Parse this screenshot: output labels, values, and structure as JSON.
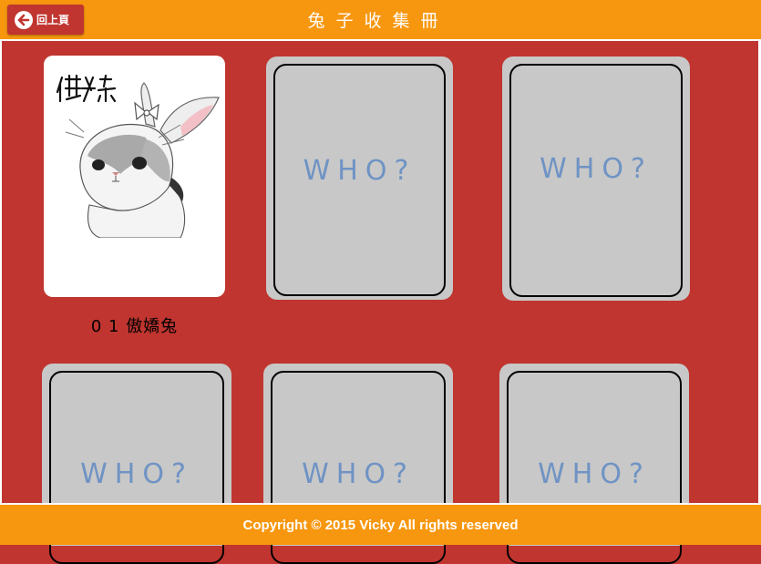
{
  "header": {
    "back_label": "回上頁",
    "title": "兔子收集冊"
  },
  "cards": [
    {
      "state": "revealed",
      "number": "0 1",
      "name": "傲嬌兔",
      "art_caption": "傲娇"
    },
    {
      "state": "hidden",
      "text": "WHO?"
    },
    {
      "state": "hidden",
      "text": "WHO?"
    },
    {
      "state": "hidden",
      "text": "WHO?"
    },
    {
      "state": "hidden",
      "text": "WHO?"
    },
    {
      "state": "hidden",
      "text": "WHO?"
    }
  ],
  "footer": {
    "copyright": "Copyright © 2015 Vicky All rights reserved"
  },
  "colors": {
    "background": "#c0352f",
    "bar": "#f7970f",
    "card_hidden": "#c8c8c8",
    "who_text": "#6f93c4"
  },
  "icons": {
    "back": "arrow-left-icon",
    "bunny": "bunny-illustration"
  }
}
